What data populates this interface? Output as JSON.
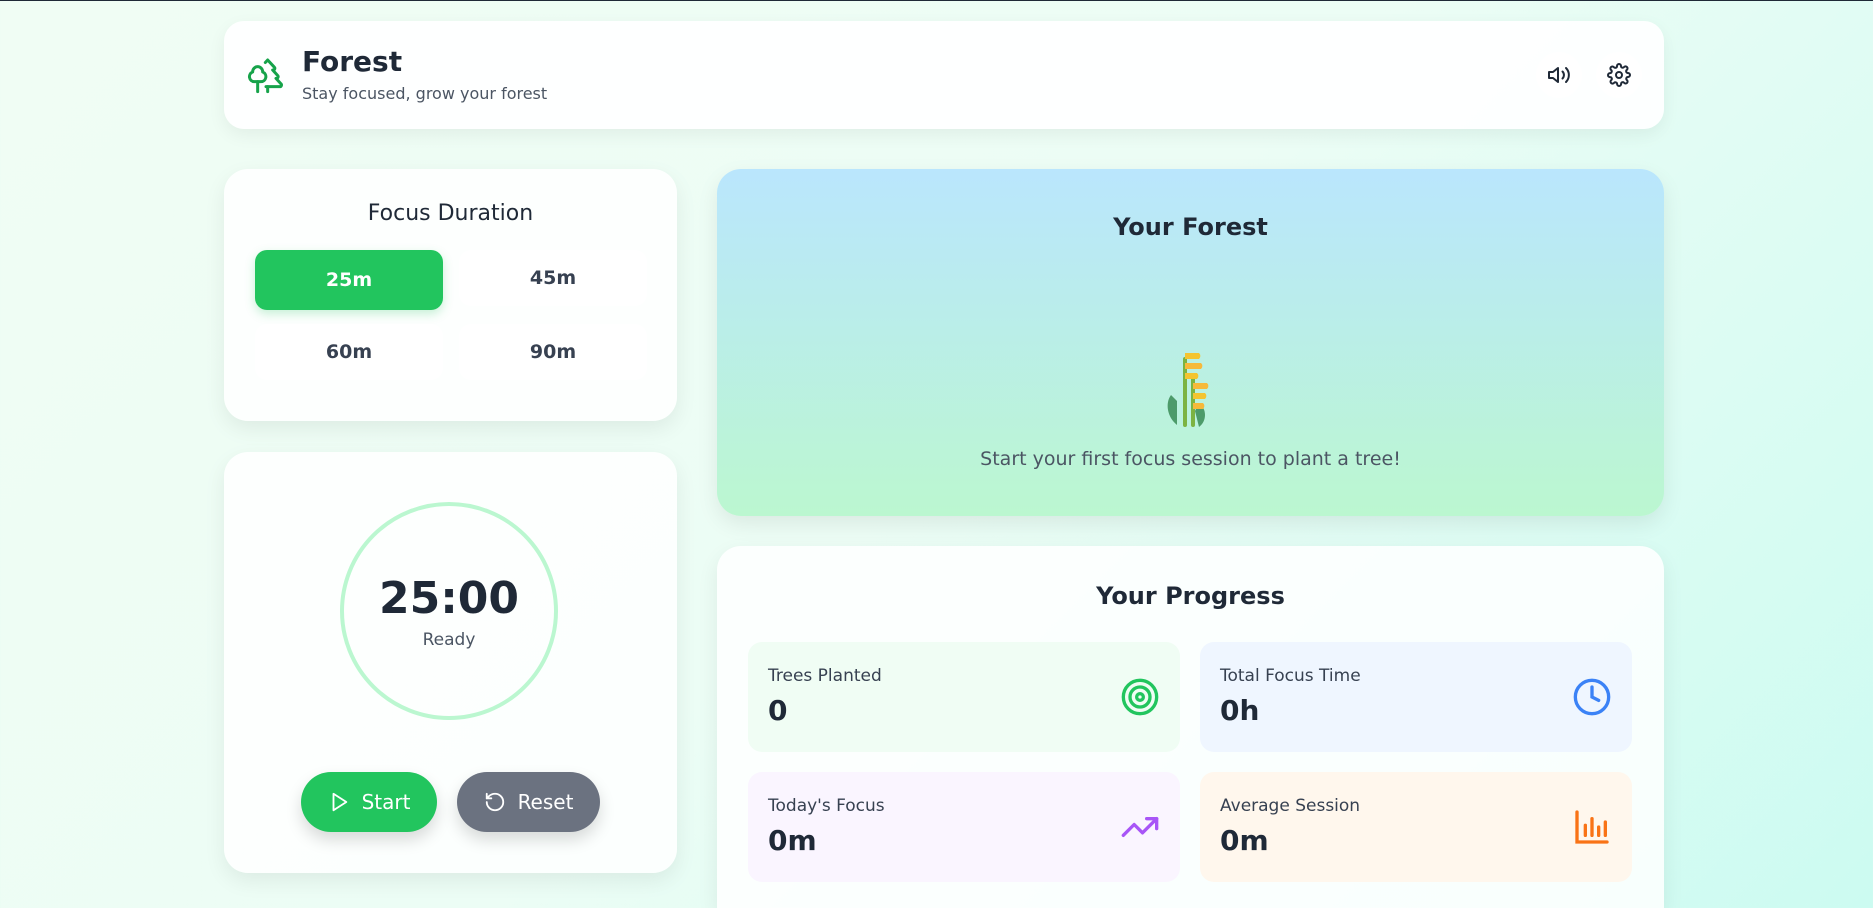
{
  "header": {
    "title": "Forest",
    "subtitle": "Stay focused, grow your forest",
    "logo_icon": "trees-icon",
    "sound_icon": "volume-icon",
    "settings_icon": "gear-icon"
  },
  "duration": {
    "title": "Focus Duration",
    "options": [
      "25m",
      "45m",
      "60m",
      "90m"
    ],
    "selected": "25m"
  },
  "timer": {
    "time": "25:00",
    "status": "Ready",
    "start_label": "Start",
    "reset_label": "Reset"
  },
  "forest": {
    "title": "Your Forest",
    "empty_message": "Start your first focus session to plant a tree!",
    "illustration_icon": "seedling-icon"
  },
  "progress": {
    "title": "Your Progress",
    "stats": [
      {
        "label": "Trees Planted",
        "value": "0",
        "icon": "target-icon",
        "color": "#22c55e"
      },
      {
        "label": "Total Focus Time",
        "value": "0h",
        "icon": "clock-icon",
        "color": "#3b82f6"
      },
      {
        "label": "Today's Focus",
        "value": "0m",
        "icon": "trending-up-icon",
        "color": "#a855f7"
      },
      {
        "label": "Average Session",
        "value": "0m",
        "icon": "bar-chart-icon",
        "color": "#f97316"
      }
    ]
  },
  "colors": {
    "accent": "#22c55e",
    "reset_button": "#6b7280"
  }
}
